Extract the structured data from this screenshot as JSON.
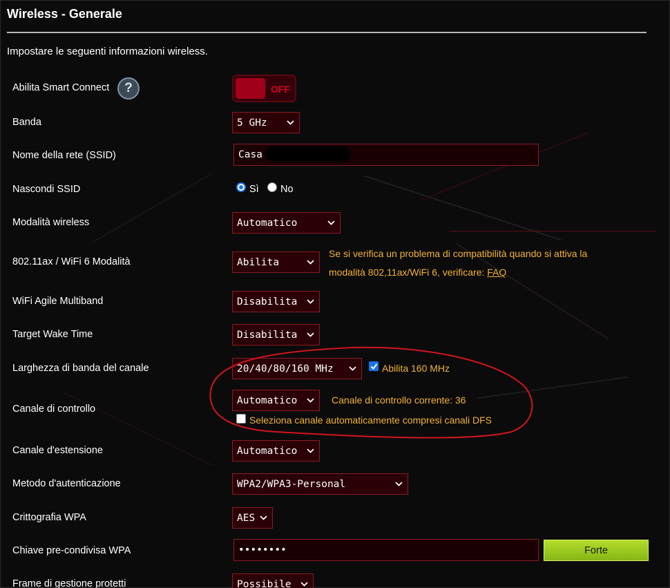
{
  "page": {
    "title": "Wireless - Generale",
    "subtitle": "Impostare le seguenti informazioni wireless."
  },
  "colors": {
    "background": "#0b0b0c",
    "field_background": "#2a0006",
    "field_border": "#8a1c22",
    "note_text": "#f2b233",
    "annotation_circle": "#d3141c",
    "strength_badge": "#9ccd1e"
  },
  "rows": {
    "smart_connect": {
      "label": "Abilita Smart Connect",
      "help_glyph": "?",
      "toggle_text": "OFF"
    },
    "band": {
      "label": "Banda",
      "value": "5 GHz"
    },
    "ssid": {
      "label": "Nome della rete (SSID)",
      "value": "Casa"
    },
    "hide_ssid": {
      "label": "Nascondi SSID",
      "option_yes": "Sì",
      "option_no": "No",
      "selected": "Sì"
    },
    "wireless_mode": {
      "label": "Modalità wireless",
      "value": "Automatico"
    },
    "wifi6": {
      "label": "802.11ax / WiFi 6 Modalità",
      "value": "Abilita",
      "note_line1": "Se si verifica un problema di compatibilità quando si attiva la",
      "note_line2": "modalità 802,11ax/WiFi 6, verificare:",
      "note_link": "FAQ"
    },
    "agile_multiband": {
      "label": "WiFi Agile Multiband",
      "value": "Disabilita"
    },
    "twt": {
      "label": "Target Wake Time",
      "value": "Disabilita"
    },
    "bandwidth": {
      "label": "Larghezza di banda del canale",
      "value": "20/40/80/160 MHz",
      "checkbox_label": "Abilita 160 MHz",
      "checkbox_checked": true
    },
    "control_channel": {
      "label": "Canale di controllo",
      "value": "Automatico",
      "current_text": "Canale di controllo corrente: 36",
      "dfs_label": "Seleziona canale automaticamente compresi canali DFS",
      "dfs_checked": false
    },
    "extension_channel": {
      "label": "Canale d'estensione",
      "value": "Automatico"
    },
    "auth_method": {
      "label": "Metodo d'autenticazione",
      "value": "WPA2/WPA3-Personal"
    },
    "wpa_encryption": {
      "label": "Crittografia WPA",
      "value": "AES"
    },
    "psk": {
      "label": "Chiave pre-condivisa WPA",
      "value": "••••••••",
      "strength": "Forte"
    },
    "pmf": {
      "label": "Frame di gestione protetti",
      "value": "Possibile"
    }
  },
  "icons": {
    "help": "question-mark-circle-icon",
    "chevron": "chevron-down-icon",
    "check": "checkmark-icon"
  }
}
